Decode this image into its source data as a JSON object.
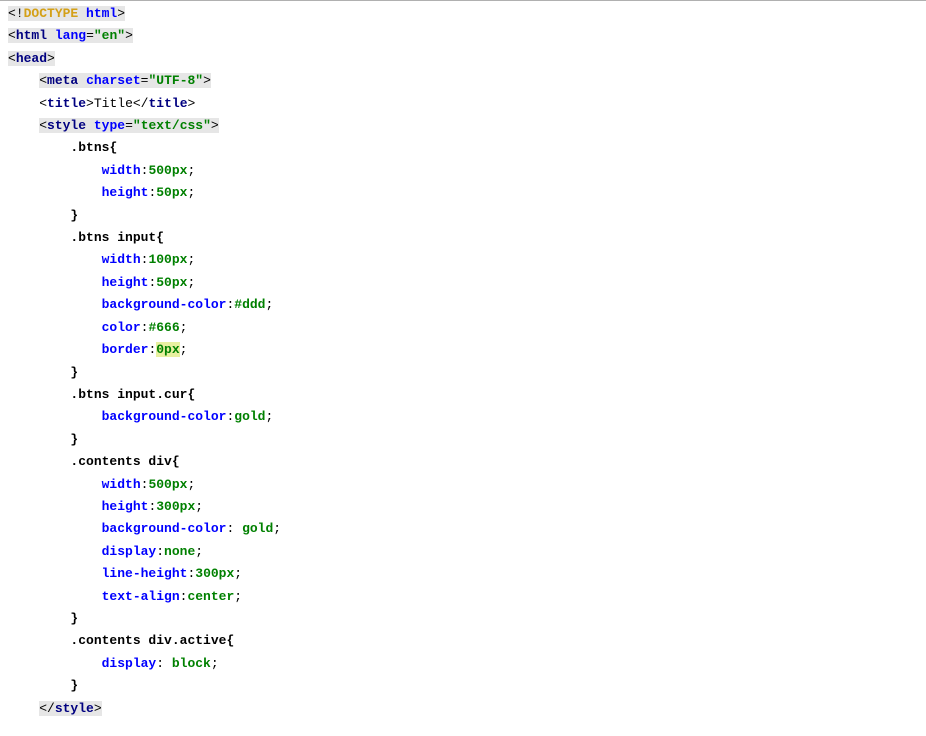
{
  "lines": [
    {
      "indent": 0,
      "type": "doctype",
      "parts": {
        "open": "<!",
        "kw": "DOCTYPE",
        "sp": " ",
        "id": "html",
        "close": ">"
      }
    },
    {
      "indent": 0,
      "type": "open-tag",
      "hl": true,
      "parts": {
        "name": "html",
        "attrs": [
          {
            "n": "lang",
            "v": "\"en\""
          }
        ]
      }
    },
    {
      "indent": 0,
      "type": "open-tag",
      "hl": true,
      "parts": {
        "name": "head"
      }
    },
    {
      "indent": 1,
      "type": "open-tag",
      "hl": true,
      "selfclose": true,
      "parts": {
        "name": "meta",
        "attrs": [
          {
            "n": "charset",
            "v": "\"UTF-8\""
          }
        ]
      }
    },
    {
      "indent": 1,
      "type": "full-tag",
      "parts": {
        "name": "title",
        "text": "Title"
      }
    },
    {
      "indent": 1,
      "type": "open-tag",
      "hl": true,
      "parts": {
        "name": "style",
        "attrs": [
          {
            "n": "type",
            "v": "\"text/css\""
          }
        ]
      }
    },
    {
      "indent": 2,
      "type": "css-sel",
      "text": ".btns{"
    },
    {
      "indent": 3,
      "type": "css-decl",
      "prop": "width",
      "val": "500px",
      "sep": ":"
    },
    {
      "indent": 3,
      "type": "css-decl",
      "prop": "height",
      "val": "50px",
      "sep": ":"
    },
    {
      "indent": 2,
      "type": "css-close"
    },
    {
      "indent": 2,
      "type": "css-sel",
      "text": ".btns input{"
    },
    {
      "indent": 3,
      "type": "css-decl",
      "prop": "width",
      "val": "100px",
      "sep": ":"
    },
    {
      "indent": 3,
      "type": "css-decl",
      "prop": "height",
      "val": "50px",
      "sep": ":"
    },
    {
      "indent": 3,
      "type": "css-decl",
      "prop": "background-color",
      "val": "#ddd",
      "sep": ":"
    },
    {
      "indent": 3,
      "type": "css-decl",
      "prop": "color",
      "val": "#666",
      "sep": ":"
    },
    {
      "indent": 3,
      "type": "css-decl",
      "prop": "border",
      "val": "0px",
      "sep": ":",
      "hlval": true
    },
    {
      "indent": 2,
      "type": "css-close"
    },
    {
      "indent": 2,
      "type": "css-sel",
      "text": ".btns input.cur{"
    },
    {
      "indent": 3,
      "type": "css-decl",
      "prop": "background-color",
      "val": "gold",
      "sep": ":"
    },
    {
      "indent": 2,
      "type": "css-close"
    },
    {
      "indent": 2,
      "type": "css-sel",
      "text": ".contents div{"
    },
    {
      "indent": 3,
      "type": "css-decl",
      "prop": "width",
      "val": "500px",
      "sep": ":"
    },
    {
      "indent": 3,
      "type": "css-decl",
      "prop": "height",
      "val": "300px",
      "sep": ":"
    },
    {
      "indent": 3,
      "type": "css-decl",
      "prop": "background-color",
      "val": " gold",
      "sep": ":"
    },
    {
      "indent": 3,
      "type": "css-decl",
      "prop": "display",
      "val": "none",
      "sep": ":"
    },
    {
      "indent": 3,
      "type": "css-decl",
      "prop": "line-height",
      "val": "300px",
      "sep": ":"
    },
    {
      "indent": 3,
      "type": "css-decl",
      "prop": "text-align",
      "val": "center",
      "sep": ":"
    },
    {
      "indent": 2,
      "type": "css-close"
    },
    {
      "indent": 2,
      "type": "css-sel",
      "text": ".contents div.active{"
    },
    {
      "indent": 3,
      "type": "css-decl",
      "prop": "display",
      "val": " block",
      "sep": ":"
    },
    {
      "indent": 2,
      "type": "css-close"
    },
    {
      "indent": 1,
      "type": "close-tag",
      "hl": true,
      "parts": {
        "name": "style"
      }
    }
  ],
  "indentUnit": "    "
}
